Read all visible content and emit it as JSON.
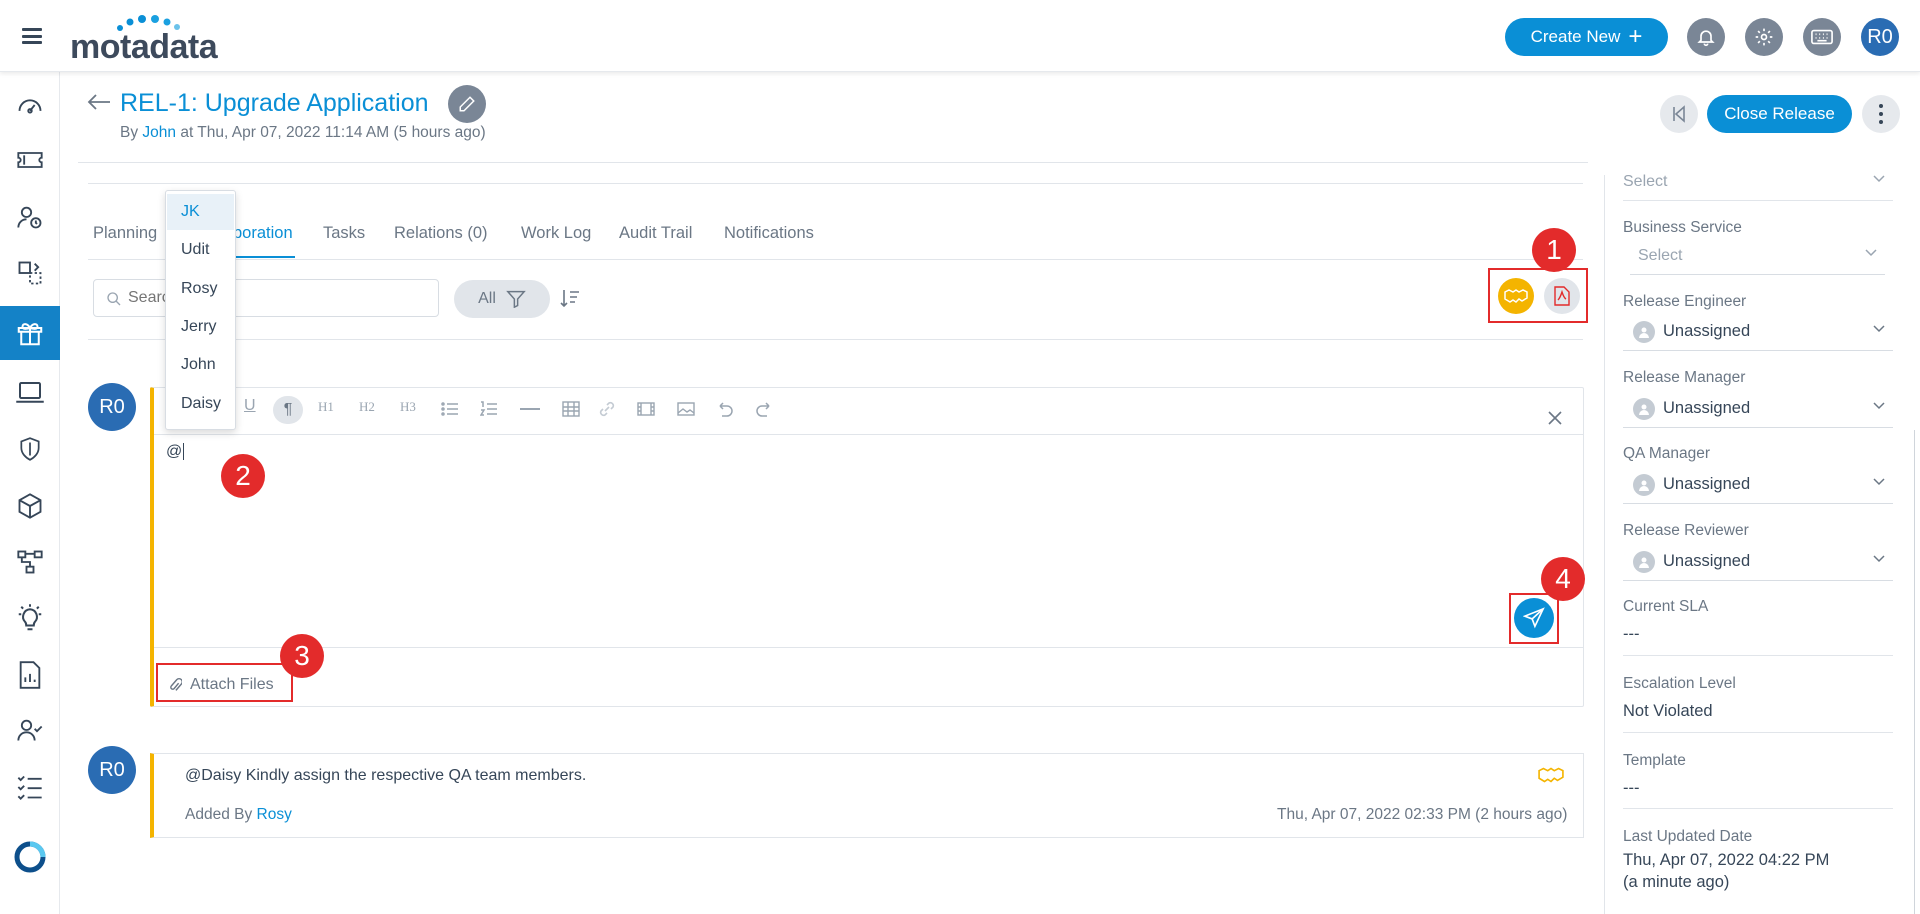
{
  "app": {
    "logo": "motadata",
    "create_new": "Create New",
    "user_initials": "R0"
  },
  "header": {
    "title": "REL-1: Upgrade Application",
    "by_prefix": "By",
    "author": "John",
    "timestamp": "at Thu, Apr 07, 2022 11:14 AM (5 hours ago)",
    "close_release": "Close Release"
  },
  "tabs": [
    {
      "label": "Planning"
    },
    {
      "label": "Collaboration"
    },
    {
      "label": "Tasks"
    },
    {
      "label": "Relations (0)"
    },
    {
      "label": "Work Log"
    },
    {
      "label": "Audit Trail"
    },
    {
      "label": "Notifications"
    }
  ],
  "tab_fragments": {
    "planning": "Planning",
    "collab_visible": "boration"
  },
  "search": {
    "placeholder": "Search"
  },
  "filter": {
    "label": "All"
  },
  "mention_list": [
    "JK",
    "Udit",
    "Rosy",
    "Jerry",
    "John",
    "Daisy"
  ],
  "editor": {
    "avatar": "R0",
    "content": "@",
    "toolbar": [
      "U",
      "¶",
      "H1",
      "H2",
      "H3"
    ],
    "attach_label": "Attach Files"
  },
  "callouts": [
    "1",
    "2",
    "3",
    "4"
  ],
  "comment": {
    "avatar": "R0",
    "text": "@Daisy Kindly assign the respective QA team members.",
    "added_by_prefix": "Added By",
    "added_by": "Rosy",
    "timestamp": "Thu, Apr 07, 2022 02:33 PM (2 hours ago)"
  },
  "right_panel": {
    "top_select": "Select",
    "business_service": {
      "label": "Business Service",
      "value": "Select"
    },
    "release_engineer": {
      "label": "Release Engineer",
      "value": "Unassigned"
    },
    "release_manager": {
      "label": "Release Manager",
      "value": "Unassigned"
    },
    "qa_manager": {
      "label": "QA Manager",
      "value": "Unassigned"
    },
    "release_reviewer": {
      "label": "Release Reviewer",
      "value": "Unassigned"
    },
    "current_sla": {
      "label": "Current SLA",
      "value": "---"
    },
    "escalation_level": {
      "label": "Escalation Level",
      "value": "Not Violated"
    },
    "template": {
      "label": "Template",
      "value": "---"
    },
    "last_updated": {
      "label": "Last Updated Date",
      "value": "Thu, Apr 07, 2022 04:22 PM",
      "relative": "(a minute ago)"
    }
  },
  "colors": {
    "accent": "#0a8fd6",
    "highlight": "#e32b2b",
    "comment_bar": "#f4b400"
  }
}
